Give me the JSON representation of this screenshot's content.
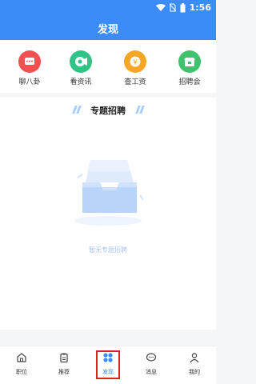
{
  "status": {
    "time": "1:56"
  },
  "header": {
    "title": "发现"
  },
  "quick_links": [
    {
      "label": "聊八卦",
      "icon": "chat-icon",
      "color": "#f0504f"
    },
    {
      "label": "看资讯",
      "icon": "news-icon",
      "color": "#2fc486"
    },
    {
      "label": "查工资",
      "icon": "salary-icon",
      "color": "#f6a623"
    },
    {
      "label": "招聘会",
      "icon": "job-fair-icon",
      "color": "#3ec26e"
    }
  ],
  "section": {
    "title": "专题招聘",
    "empty_text": "暂无专题招聘"
  },
  "tabs": [
    {
      "label": "职位",
      "icon": "home-icon"
    },
    {
      "label": "推荐",
      "icon": "clipboard-icon"
    },
    {
      "label": "发现",
      "icon": "discover-icon",
      "active": true
    },
    {
      "label": "消息",
      "icon": "message-icon"
    },
    {
      "label": "我的",
      "icon": "profile-icon"
    }
  ],
  "accent": "#3b8cf8",
  "highlight": "#e02020"
}
